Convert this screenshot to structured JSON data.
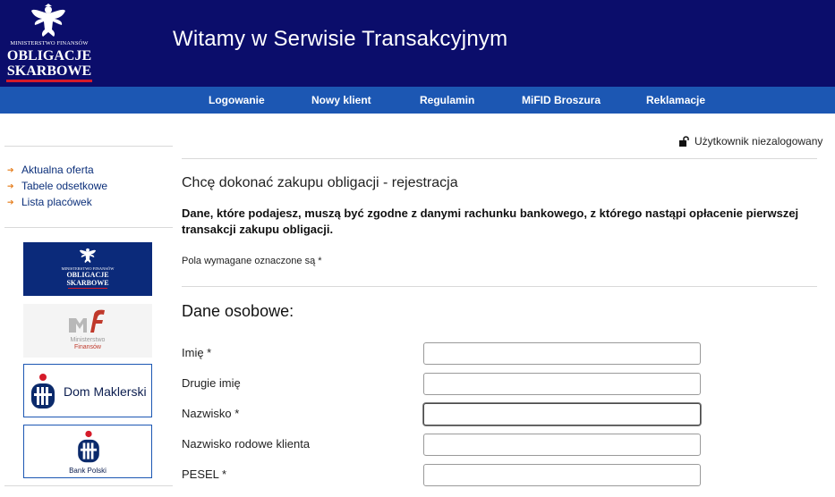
{
  "header": {
    "logo": {
      "ministry": "MINISTERSTWO FINANSÓW",
      "brand_line1": "OBLIGACJE",
      "brand_line2": "SKARBOWE",
      "icon": "eagle-emblem-icon"
    },
    "title": "Witamy w Serwisie Transakcyjnym"
  },
  "nav": {
    "items": [
      {
        "label": "Logowanie"
      },
      {
        "label": "Nowy klient"
      },
      {
        "label": "Regulamin"
      },
      {
        "label": "MiFID Broszura"
      },
      {
        "label": "Reklamacje"
      }
    ]
  },
  "sidebar": {
    "links": [
      {
        "label": "Aktualna oferta"
      },
      {
        "label": "Tabele odsetkowe"
      },
      {
        "label": "Lista placówek"
      }
    ],
    "promos": {
      "obligacje": {
        "ministry": "MINISTERSTWO FINANSÓW",
        "line1": "OBLIGACJE",
        "line2": "SKARBOWE"
      },
      "mf": {
        "line1": "Ministerstwo",
        "line2": "Finansów"
      },
      "dom_maklerski": {
        "label": "Dom Maklerski"
      },
      "bank_polski": {
        "label": "Bank Polski"
      }
    }
  },
  "user": {
    "status": "Użytkownik niezalogowany",
    "icon": "lock-open-icon"
  },
  "main": {
    "heading": "Chcę dokonać zakupu obligacji - rejestracja",
    "notice": "Dane, które podajesz, muszą być zgodne z danymi rachunku bankowego, z którego nastąpi opłacenie pierwszej transakcji zakupu obligacji.",
    "required_note": "Pola wymagane oznaczone są *",
    "section_title": "Dane osobowe:",
    "fields": [
      {
        "label": "Imię *",
        "value": ""
      },
      {
        "label": "Drugie imię",
        "value": ""
      },
      {
        "label": "Nazwisko *",
        "value": ""
      },
      {
        "label": "Nazwisko rodowe klienta",
        "value": ""
      },
      {
        "label": "PESEL *",
        "value": ""
      }
    ]
  },
  "colors": {
    "header_bg": "#0b0d6b",
    "nav_bg": "#1c57b3",
    "accent_red": "#d51b2a",
    "link_arrow": "#e57a17"
  }
}
